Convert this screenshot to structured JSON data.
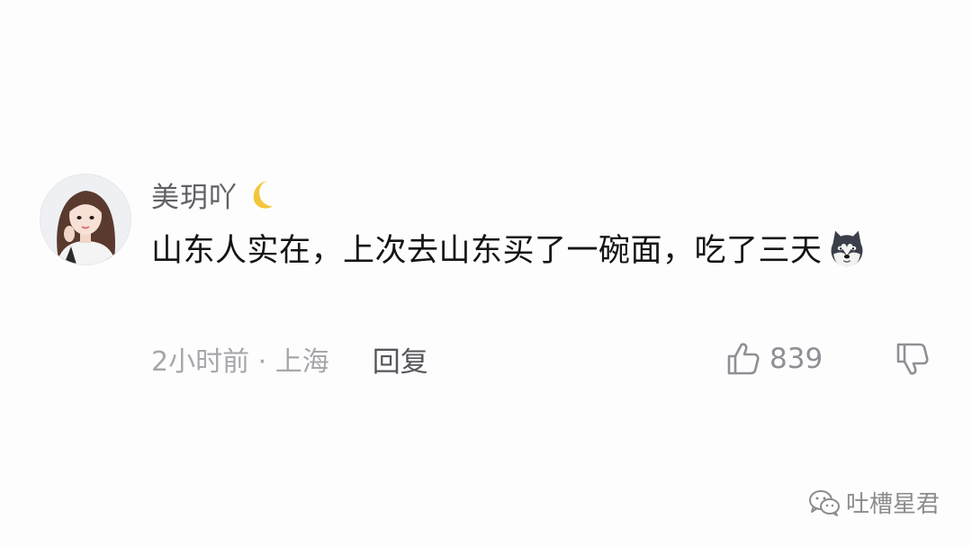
{
  "comment": {
    "username": "美玥吖",
    "badge_icon": "crescent-moon-icon",
    "text": "山东人实在，上次去山东买了一碗面，吃了三天",
    "emoji": "husky-dog-emoji",
    "time_location": "2小时前 · 上海",
    "reply_label": "回复",
    "like_count": "839",
    "like_icon": "thumbs-up-icon",
    "dislike_icon": "thumbs-down-icon"
  },
  "watermark": {
    "text": "吐槽星君",
    "icon": "wechat-icon"
  },
  "colors": {
    "username": "#5f6166",
    "body_text": "#151515",
    "meta_text": "#a5a7ab",
    "moon": "#f3c63a"
  }
}
